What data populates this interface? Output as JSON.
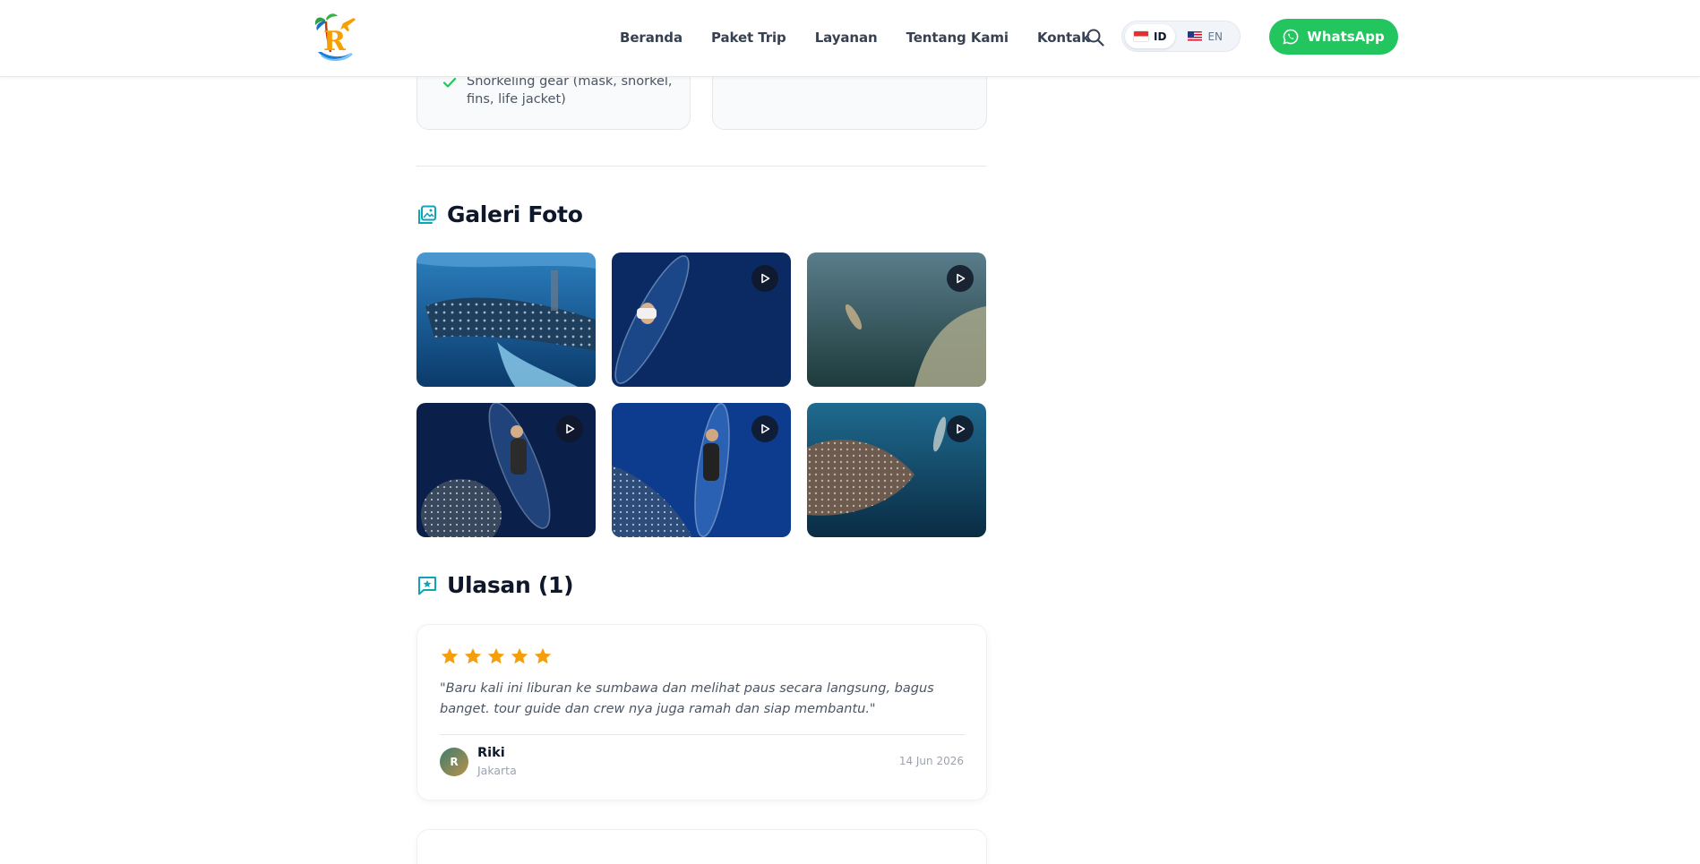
{
  "header": {
    "nav": [
      "Beranda",
      "Paket Trip",
      "Layanan",
      "Tentang Kami",
      "Kontak"
    ],
    "lang_active": "ID",
    "lang_other": "EN",
    "whatsapp_label": "WhatsApp",
    "colors": {
      "whatsapp": "#22c55e",
      "accent": "#0ea5b7"
    }
  },
  "included": {
    "last_item": "Snorkeling gear (mask, snorkel, fins, life jacket)"
  },
  "gallery": {
    "title": "Galeri Foto",
    "items": [
      {
        "scene": "whale-shark-underwater",
        "video": false
      },
      {
        "scene": "clear-kayak-aerial",
        "video": true
      },
      {
        "scene": "swimmer-murky-water",
        "video": true
      },
      {
        "scene": "clear-kayak-with-whale-shark",
        "video": true
      },
      {
        "scene": "clear-kayak-whale-shark-blue",
        "video": true
      },
      {
        "scene": "whale-shark-and-snorkeler",
        "video": true
      }
    ]
  },
  "reviews": {
    "title": "Ulasan (1)",
    "items": [
      {
        "rating": 5,
        "text": "\"Baru kali ini liburan ke sumbawa dan melihat paus secara langsung, bagus banget. tour guide dan crew nya juga ramah dan siap membantu.\"",
        "initial": "R",
        "name": "Riki",
        "city": "Jakarta",
        "date": "14 Jun 2026"
      }
    ]
  }
}
